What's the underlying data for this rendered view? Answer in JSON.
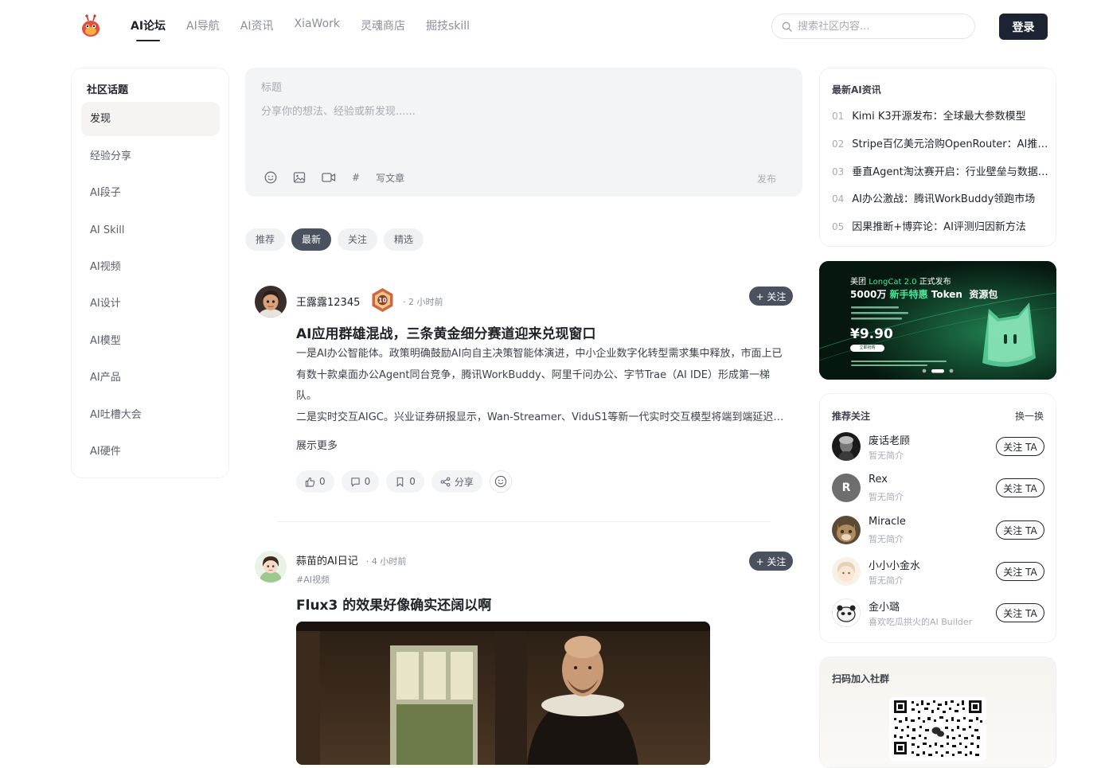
{
  "header": {
    "nav": [
      "AI论坛",
      "AI导航",
      "AI资讯",
      "XiaWork",
      "灵魂商店",
      "掘技skill"
    ],
    "search_placeholder": "搜索社区内容...",
    "login_label": "登录"
  },
  "sidebar": {
    "title": "社区话题",
    "items": [
      "发现",
      "经验分享",
      "AI段子",
      "AI Skill",
      "AI视频",
      "AI设计",
      "AI模型",
      "AI产品",
      "AI吐槽大会",
      "AI硬件"
    ]
  },
  "composer": {
    "title_placeholder": "标题",
    "body_placeholder": "分享你的想法、经验或新发现......",
    "write_article": "写文章",
    "hash": "#",
    "publish": "发布"
  },
  "filters": [
    "推荐",
    "最新",
    "关注",
    "精选"
  ],
  "posts": [
    {
      "author": "王露露12345",
      "level_badge": "10",
      "time": "· 2 小时前",
      "follow": "+ 关注",
      "title": "AI应用群雄混战，三条黄金细分赛道迎来兑现窗口",
      "para1": "一是AI办公智能体。政策明确鼓励AI向自主决策智能体演进，中小企业数字化转型需求集中释放，市面上已有数十款桌面办公Agent同台竞争，腾讯WorkBuddy、阿里千问办公、字节Trae（AI IDE）形成第一梯队。",
      "para2": "二是实时交互AIGC。兴业证券研报显示，Wan-Streamer、ViduS1等新一代实时交互模型将端到端延迟压缩至秒级。",
      "more": "展示更多",
      "likes": "0",
      "comments": "0",
      "bookmarks": "0",
      "share": "分享"
    },
    {
      "author": "蒜苗的AI日记",
      "time": "· 4 小时前",
      "tag": "#AI视频",
      "follow": "+ 关注",
      "title": "Flux3 的效果好像确实还阔以啊"
    }
  ],
  "news": {
    "title": "最新AI资讯",
    "items": [
      {
        "num": "01",
        "text": "Kimi K3开源发布：全球最大参数模型"
      },
      {
        "num": "02",
        "text": "Stripe百亿美元洽购OpenRouter：AI推理市场"
      },
      {
        "num": "03",
        "text": "垂直Agent淘汰赛开启：行业壁垒与数据护城河"
      },
      {
        "num": "04",
        "text": "AI办公激战：腾讯WorkBuddy领跑市场"
      },
      {
        "num": "05",
        "text": "因果推断+博弈论：AI评测归因新方法"
      }
    ]
  },
  "banner": {
    "line1_prefix": "美团",
    "line1_highlight": "LongCat 2.0",
    "line1_suffix": "正式发布",
    "line2_prefix": "5000万",
    "line2_highlight": "新手特惠",
    "line2_suffix": "Token  资源包",
    "price": "¥9.90",
    "cta": "立即抢购"
  },
  "recommend": {
    "title": "推荐关注",
    "swap": "换一换",
    "follow_label": "关注 TA",
    "users": [
      {
        "name": "废话老顾",
        "bio": "暂无简介",
        "initial": ""
      },
      {
        "name": "Rex",
        "bio": "暂无简介",
        "initial": "R"
      },
      {
        "name": "Miracle",
        "bio": "暂无简介",
        "initial": ""
      },
      {
        "name": "小小小金水",
        "bio": "暂无简介",
        "initial": ""
      },
      {
        "name": "金小璐",
        "bio": "喜欢吃瓜拱火的AI Builder",
        "initial": ""
      }
    ]
  },
  "qr": {
    "title": "扫码加入社群"
  },
  "colors": {
    "primary_dark": "#1c2433",
    "chip_active": "#4a5260",
    "banner_accent": "#4ee39a"
  }
}
